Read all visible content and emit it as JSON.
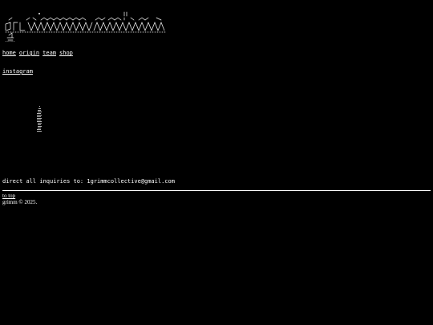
{
  "header": {
    "logo_name": "grimm collective logo"
  },
  "nav": {
    "items": [
      {
        "label": "home"
      },
      {
        "label": "origin"
      },
      {
        "label": "team"
      },
      {
        "label": "shop"
      }
    ]
  },
  "social": {
    "instagram_label": "instagram"
  },
  "contact": {
    "inquiry_text": "direct all inquiries to: 1grimmcollective@gmail.com"
  },
  "footer": {
    "to_top_label": "to top",
    "copyright_text": "grimm © 2025."
  },
  "colors": {
    "background": "#000000",
    "text": "#ffffff"
  }
}
